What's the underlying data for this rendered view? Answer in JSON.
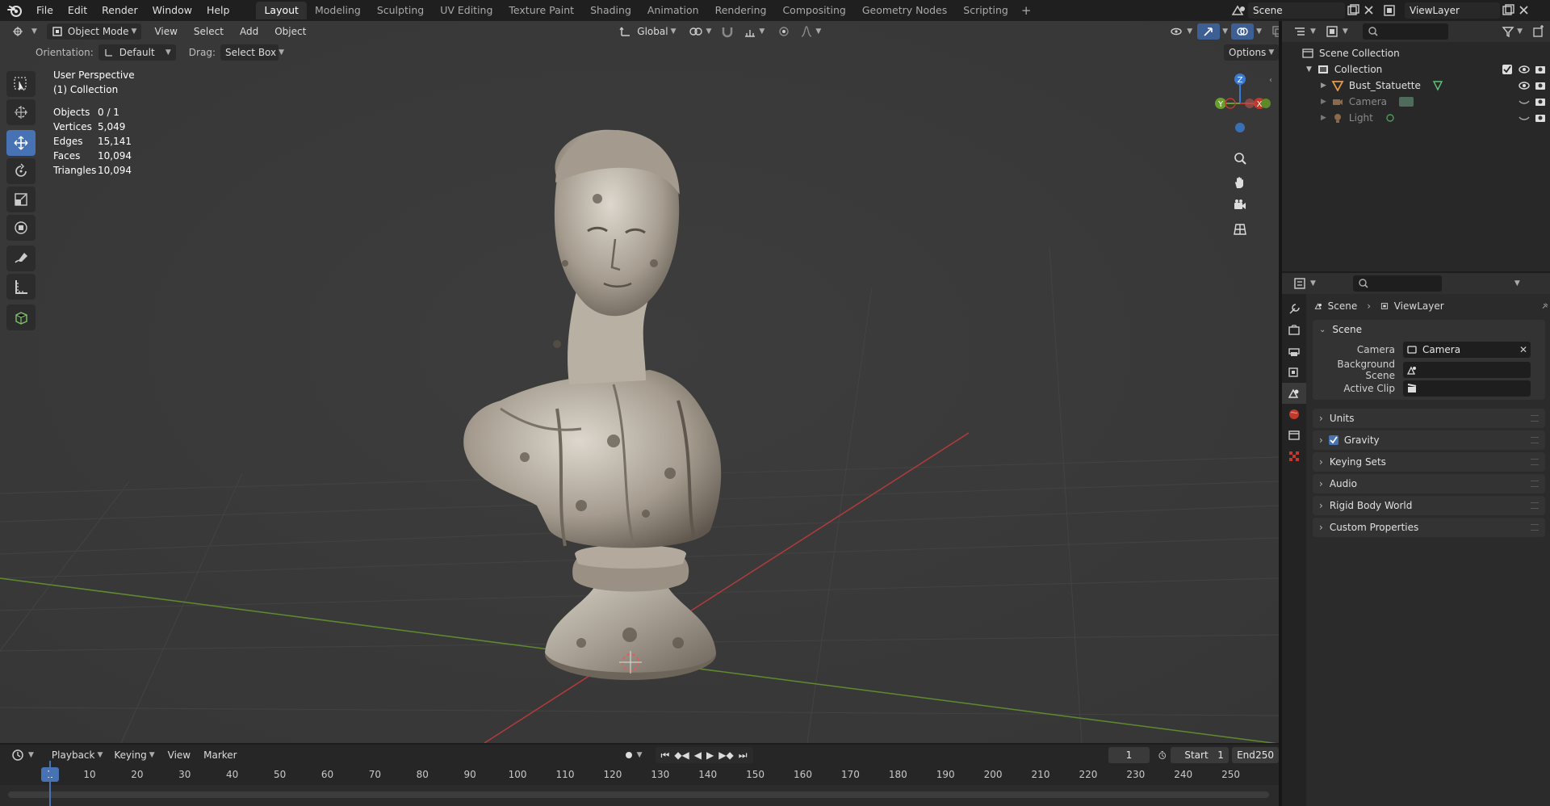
{
  "topbar": {
    "menus": [
      "File",
      "Edit",
      "Render",
      "Window",
      "Help"
    ],
    "workspaces": [
      "Layout",
      "Modeling",
      "Sculpting",
      "UV Editing",
      "Texture Paint",
      "Shading",
      "Animation",
      "Rendering",
      "Compositing",
      "Geometry Nodes",
      "Scripting"
    ],
    "active_workspace": "Layout",
    "add_workspace": "+",
    "scene": "Scene",
    "view_layer": "ViewLayer"
  },
  "viewport": {
    "mode": "Object Mode",
    "menus": [
      "View",
      "Select",
      "Add",
      "Object"
    ],
    "orientation_label": "Orientation:",
    "orientation_value": "Default",
    "drag_label": "Drag:",
    "drag_value": "Select Box",
    "transform_space": "Global",
    "options_label": "Options",
    "overlay_title": "User Perspective",
    "overlay_collection": "(1) Collection",
    "stats": [
      {
        "label": "Objects",
        "value": "0 / 1"
      },
      {
        "label": "Vertices",
        "value": "5,049"
      },
      {
        "label": "Edges",
        "value": "15,141"
      },
      {
        "label": "Faces",
        "value": "10,094"
      },
      {
        "label": "Triangles",
        "value": "10,094"
      }
    ],
    "gizmo_axes": {
      "z": "Z",
      "y": "Y",
      "x": "X"
    }
  },
  "outliner": {
    "root": "Scene Collection",
    "collection": "Collection",
    "items": [
      {
        "name": "Bust_Statuette",
        "type": "mesh"
      },
      {
        "name": "Camera",
        "type": "camera"
      },
      {
        "name": "Light",
        "type": "light"
      }
    ]
  },
  "properties": {
    "breadcrumb_scene": "Scene",
    "breadcrumb_layer": "ViewLayer",
    "scene_panel": "Scene",
    "camera_label": "Camera",
    "camera_value": "Camera",
    "background_scene_label": "Background Scene",
    "active_clip_label": "Active Clip",
    "collapsed_panels": [
      "Units",
      "Gravity",
      "Keying Sets",
      "Audio",
      "Rigid Body World",
      "Custom Properties"
    ],
    "gravity_enabled": true
  },
  "timeline": {
    "menus": [
      "Playback",
      "Keying",
      "View",
      "Marker"
    ],
    "current_frame": "1",
    "start_label": "Start",
    "start_value": "1",
    "end_label": "End",
    "end_value": "250",
    "playhead": "1",
    "ticks": [
      "10",
      "20",
      "30",
      "40",
      "50",
      "60",
      "70",
      "80",
      "90",
      "100",
      "110",
      "120",
      "130",
      "140",
      "150",
      "160",
      "170",
      "180",
      "190",
      "200",
      "210",
      "220",
      "230",
      "240",
      "250"
    ]
  },
  "colors": {
    "accent": "#4772b3",
    "x_axis": "#c0392b",
    "y_axis": "#6a9e2e",
    "z_axis": "#3b7bd4"
  }
}
